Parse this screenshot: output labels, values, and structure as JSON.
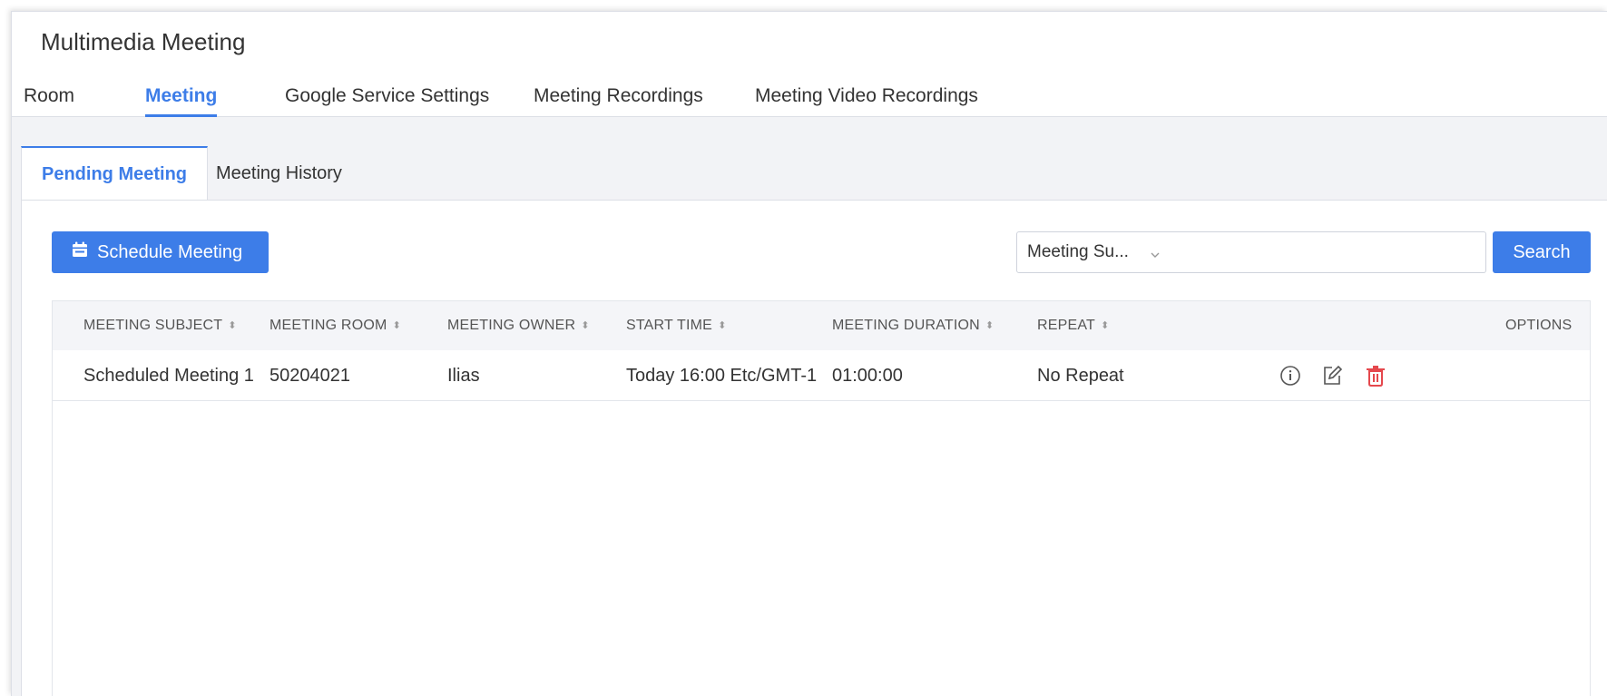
{
  "app": {
    "title": "Multimedia Meeting"
  },
  "top_tabs": [
    {
      "label": "Room",
      "active": false
    },
    {
      "label": "Meeting",
      "active": true
    },
    {
      "label": "Google Service Settings",
      "active": false
    },
    {
      "label": "Meeting Recordings",
      "active": false
    },
    {
      "label": "Meeting Video Recordings",
      "active": false
    }
  ],
  "sub_tabs": [
    {
      "label": "Pending Meeting",
      "active": true
    },
    {
      "label": "Meeting History",
      "active": false
    }
  ],
  "toolbar": {
    "schedule_label": "Schedule Meeting",
    "filter_selected": "Meeting Su...",
    "search_value": "",
    "search_label": "Search"
  },
  "table": {
    "columns": [
      "MEETING SUBJECT",
      "MEETING ROOM",
      "MEETING OWNER",
      "START TIME",
      "MEETING DURATION",
      "REPEAT",
      "OPTIONS"
    ],
    "rows": [
      {
        "subject": "Scheduled Meeting 1",
        "room": "50204021",
        "owner": "Ilias",
        "start_time": "Today 16:00 Etc/GMT-1",
        "duration": "01:00:00",
        "repeat": "No Repeat"
      }
    ]
  },
  "colors": {
    "accent": "#3d7de8",
    "danger": "#e5484d",
    "icon": "#555555"
  },
  "icons": [
    "calendar-icon",
    "chevron-down-icon",
    "sort-icon",
    "info-icon",
    "edit-icon",
    "delete-icon"
  ]
}
